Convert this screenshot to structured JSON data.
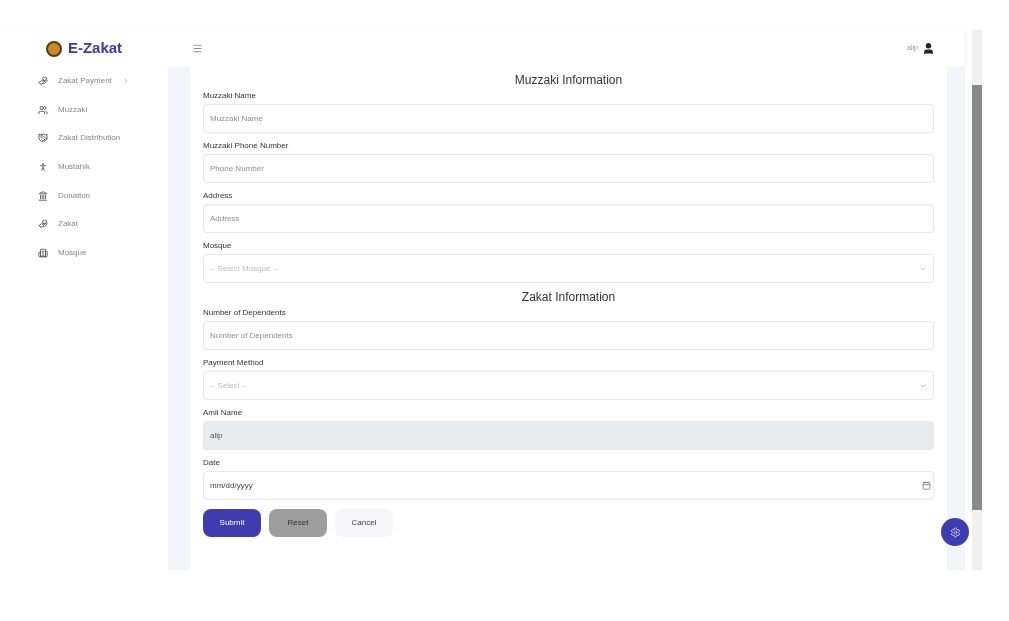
{
  "brand": "E-Zakat",
  "user": "alip",
  "sidebar": {
    "items": [
      {
        "label": "Zakat Payment",
        "has_submenu": true
      },
      {
        "label": "Muzzaki",
        "has_submenu": false
      },
      {
        "label": "Zakat Distribution",
        "has_submenu": false
      },
      {
        "label": "Mustahik",
        "has_submenu": false
      },
      {
        "label": "Donation",
        "has_submenu": false
      },
      {
        "label": "Zakat",
        "has_submenu": false
      },
      {
        "label": "Mosque",
        "has_submenu": false
      }
    ]
  },
  "sections": [
    {
      "title": "Muzzaki Information",
      "fields": [
        {
          "label": "Muzzaki Name",
          "kind": "input",
          "placeholder": "Muzzaki Name"
        },
        {
          "label": "Muzzaki Phone Number",
          "kind": "input",
          "placeholder": "Phone Number"
        },
        {
          "label": "Address",
          "kind": "input",
          "placeholder": "Address"
        },
        {
          "label": "Mosque",
          "kind": "select",
          "placeholder": "-- Select Mosque --"
        }
      ]
    },
    {
      "title": "Zakat Information",
      "fields": [
        {
          "label": "Number of Dependents",
          "kind": "input",
          "placeholder": "Number of Dependents"
        },
        {
          "label": "Payment Method",
          "kind": "select",
          "placeholder": "-- Select --"
        },
        {
          "label": "Amil Name",
          "kind": "readonly",
          "value": "alip"
        },
        {
          "label": "Date",
          "kind": "date",
          "value": "mm/dd/yyyy"
        }
      ]
    }
  ],
  "buttons": [
    {
      "label": "Submit",
      "kind": "primary"
    },
    {
      "label": "Reset",
      "kind": "secondary"
    },
    {
      "label": "Cancel",
      "kind": "plain"
    }
  ]
}
